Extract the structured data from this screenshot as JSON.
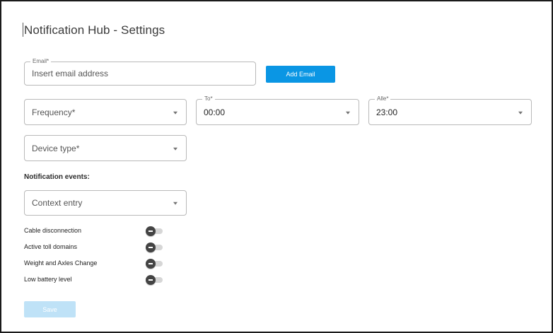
{
  "header": {
    "title": "Notification Hub - Settings"
  },
  "email": {
    "label": "Email*",
    "placeholder": "Insert email address"
  },
  "add_email_label": "Add Email",
  "frequency": {
    "placeholder": "Frequency*"
  },
  "to": {
    "label": "To*",
    "value": "00:00"
  },
  "alle": {
    "label": "Alle*",
    "value": "23:00"
  },
  "device_type": {
    "placeholder": "Device type*"
  },
  "notification_events_label": "Notification events:",
  "context_entry": {
    "placeholder": "Context entry"
  },
  "events": [
    {
      "label": "Cable disconnection",
      "enabled": false
    },
    {
      "label": "Active toll domains",
      "enabled": false
    },
    {
      "label": "Weight and Axles Change",
      "enabled": false
    },
    {
      "label": "Low battery level",
      "enabled": false
    }
  ],
  "save_label": "Save",
  "colors": {
    "primary": "#0a96e4",
    "primary_disabled": "#bfe2f7",
    "toggle_thumb": "#444444",
    "border": "#b9b9b9"
  }
}
